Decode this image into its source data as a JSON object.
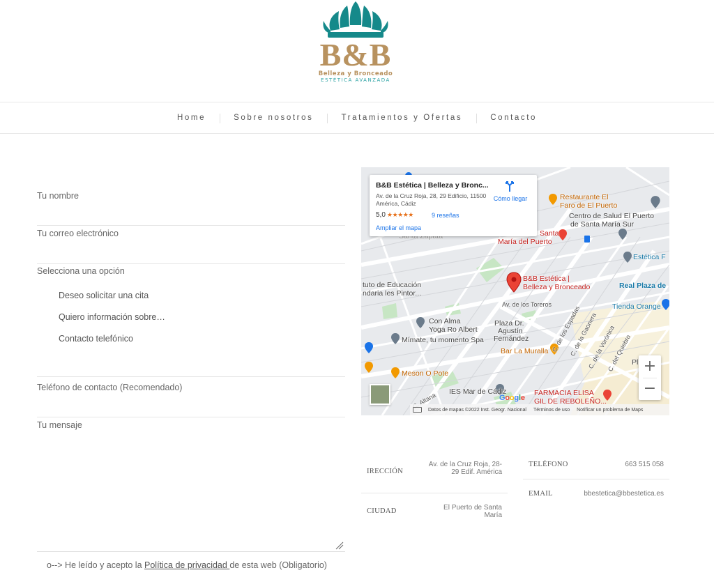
{
  "logo": {
    "text": "B&B",
    "subtitle": "Belleza y Bronceado",
    "tagline": "ESTÉTICA AVANZADA",
    "colors": {
      "teal": "#15898a",
      "gold": "#b8925f",
      "light_teal": "#2aa1a3"
    }
  },
  "nav": {
    "items": [
      {
        "label": "Home"
      },
      {
        "label": "Sobre nosotros"
      },
      {
        "label": "Tratamientos y Ofertas"
      },
      {
        "label": "Contacto"
      }
    ]
  },
  "form": {
    "name_label": "Tu nombre",
    "email_label": "Tu correo electrónico",
    "option_label": "Selecciona una opción",
    "options": [
      {
        "label": "Deseo solicitar una cita"
      },
      {
        "label": "Quiero información sobre…"
      },
      {
        "label": "Contacto telefónico"
      }
    ],
    "phone_label": "Teléfono de contacto (Recomendado)",
    "message_label": "Tu mensaje",
    "privacy_prefix": "o--> He leído y acepto la ",
    "privacy_link": "Política de privacidad ",
    "privacy_suffix": "de esta web (Obligatorio)"
  },
  "map": {
    "card": {
      "title": "B&B Estética | Belleza y Bronc...",
      "address": "Av. de la Cruz Roja, 28, 29 Edificio, 11500 América, Cádiz",
      "rating": "5,0",
      "stars": "★★★★★",
      "reviews": "9 reseñas",
      "enlarge": "Ampliar el mapa",
      "directions": "Cómo llegar"
    },
    "labels": {
      "restaurante_1": "Restaurante El",
      "restaurante_2": "Faro de El Puerto",
      "centro_1": "Centro de Salud El Puerto",
      "centro_2": "de Santa María Sur",
      "santa_1": "Santa",
      "santa_2": "María del Puerto",
      "santa_zapata": "Santa Zapata",
      "estetica_right": "Estética F",
      "instituto_1": "tuto de Educación",
      "instituto_2": "ndaria les Pintor...",
      "bb_1": "B&B Estética |",
      "bb_2": "Belleza y Bronceado",
      "real_plaza": "Real Plaza de",
      "av_toreros": "Av. de los Toreros",
      "tienda": "Tienda Orange",
      "con_alma_1": "Con Alma",
      "con_alma_2": "Yoga Ro Albert",
      "plaza_1": "Plaza Dr.",
      "plaza_2": "Agustín",
      "plaza_3": "Fernández",
      "mimate": "Mímate, tu momento Spa",
      "bar": "Bar La Muralla",
      "meson": "Meson O Pote",
      "ies": "IES Mar de Cádiz",
      "farmacia_1": "FARMACIA ELISA",
      "farmacia_2": "GIL DE REBOLEÑO...",
      "c_espadas": "C. de los Espadas",
      "c_gaonera": "C. de la Gaonera",
      "c_veronica": "C. de la Verónica",
      "c_quiebro": "C. del Quiebro",
      "c_altana": "C. Altana",
      "pl_right": "Pl"
    },
    "google": "Google",
    "attribution": {
      "data": "Datos de mapas ©2022 Inst. Geogr. Nacional",
      "terms": "Términos de uso",
      "report": "Notificar un problema de Maps"
    },
    "zoom_in": "+",
    "zoom_out": "−"
  },
  "info": {
    "direccion_label": "IRECCIÓN",
    "direccion_value": "Av. de la Cruz Roja, 28-29 Edif. América",
    "ciudad_label": "CIUDAD",
    "ciudad_value": "El Puerto de Santa María",
    "telefono_label": "TELÉFONO",
    "telefono_value": "663 515 058",
    "email_label": "EMAIL",
    "email_value": "bbestetica@bbestetica.es"
  }
}
